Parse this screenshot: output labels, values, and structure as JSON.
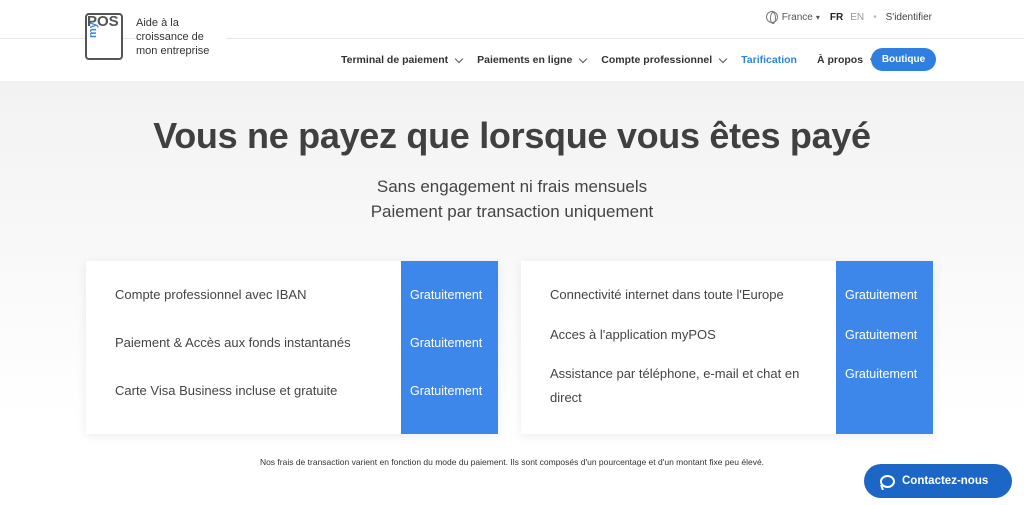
{
  "header": {
    "logo": {
      "pos": "POS",
      "my": "my"
    },
    "tagline": "Aide à la croissance de mon entreprise",
    "topbar": {
      "country": "France",
      "lang_active": "FR",
      "lang_other": "EN",
      "separator": "•",
      "login": "S'identifier"
    },
    "nav": [
      {
        "label": "Terminal de paiement"
      },
      {
        "label": "Paiements en ligne"
      },
      {
        "label": "Compte professionnel"
      },
      {
        "label": "Tarification"
      },
      {
        "label": "À propos"
      }
    ],
    "shop_button": "Boutique"
  },
  "hero": {
    "title": "Vous ne payez que lorsque vous êtes payé",
    "subtitle_line1": "Sans engagement ni frais mensuels",
    "subtitle_line2": "Paiement par transaction uniquement"
  },
  "cards": {
    "left": [
      {
        "label": "Compte professionnel avec IBAN",
        "value": "Gratuitement"
      },
      {
        "label": "Paiement & Accès aux fonds instantanés",
        "value": "Gratuitement"
      },
      {
        "label": "Carte Visa Business incluse et gratuite",
        "value": "Gratuitement"
      }
    ],
    "right": [
      {
        "label": "Connectivité internet dans toute l'Europe",
        "value": "Gratuitement"
      },
      {
        "label": "Acces à l'application myPOS",
        "value": "Gratuitement"
      },
      {
        "label": "Assistance par téléphone, e-mail et chat en direct",
        "value": "Gratuitement"
      }
    ]
  },
  "footnote": "Nos frais de transaction varient en fonction du mode du paiement. Ils sont composés d'un pourcentage et d'un montant fixe peu élevé.",
  "contact_button": "Contactez-nous",
  "colors": {
    "accent": "#2f7fe0",
    "card_blue": "#3d87ea",
    "contact": "#1c66c6"
  }
}
